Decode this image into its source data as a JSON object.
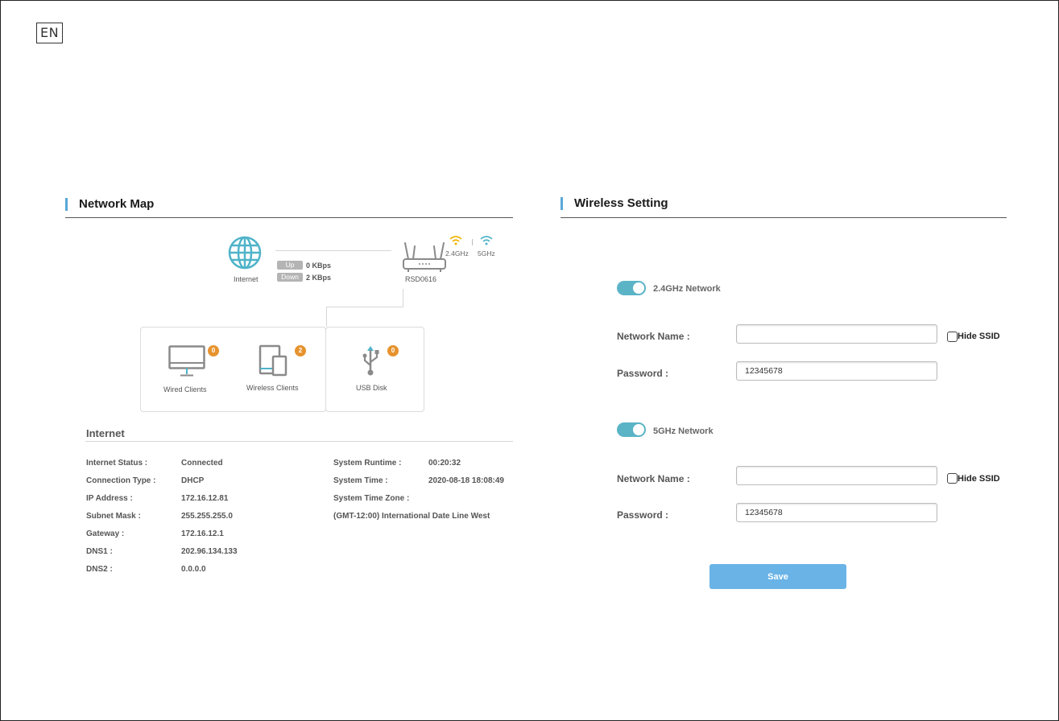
{
  "language": "EN",
  "network_map": {
    "title": "Network Map",
    "internet_label": "Internet",
    "up_tag": "Up",
    "up_value": "0 KBps",
    "down_tag": "Down",
    "down_value": "2 KBps",
    "router_name": "RSD0616",
    "band_24": "2.4GHz",
    "band_5": "5GHz",
    "band_24_color": "#f0b400",
    "band_5_color": "#4fb3c9",
    "clients": [
      {
        "label": "Wired Clients",
        "count": "0",
        "icon": "monitor-icon"
      },
      {
        "label": "Wireless Clients",
        "count": "2",
        "icon": "devices-icon"
      },
      {
        "label": "USB Disk",
        "count": "0",
        "icon": "usb-icon"
      }
    ],
    "badge_color": "#e6932e"
  },
  "internet": {
    "title": "Internet",
    "left": [
      {
        "label": "Internet Status :",
        "value": "Connected"
      },
      {
        "label": "Connection Type :",
        "value": "DHCP"
      },
      {
        "label": "IP Address :",
        "value": "172.16.12.81"
      },
      {
        "label": "Subnet Mask :",
        "value": "255.255.255.0"
      },
      {
        "label": "Gateway :",
        "value": "172.16.12.1"
      },
      {
        "label": "DNS1 :",
        "value": "202.96.134.133"
      },
      {
        "label": "DNS2 :",
        "value": "0.0.0.0"
      }
    ],
    "right": [
      {
        "label": "System Runtime :",
        "value": "00:20:32"
      },
      {
        "label": "System Time :",
        "value": "2020-08-18 18:08:49"
      },
      {
        "label": "System Time Zone :",
        "value": ""
      },
      {
        "label": "(GMT-12:00) International Date Line West",
        "value": ""
      }
    ]
  },
  "wireless": {
    "title": "Wireless Setting",
    "accent_color": "#5ab4c6",
    "band24": {
      "toggle_label": "2.4GHz Network",
      "enabled": true,
      "name_label": "Network Name :",
      "name_value": "",
      "hide_ssid_label": "Hide SSID",
      "hide_ssid_checked": false,
      "password_label": "Password :",
      "password_value": "12345678"
    },
    "band5": {
      "toggle_label": "5GHz Network",
      "enabled": true,
      "name_label": "Network Name :",
      "name_value": "",
      "hide_ssid_label": "Hide SSID",
      "hide_ssid_checked": false,
      "password_label": "Password :",
      "password_value": "12345678"
    },
    "save_label": "Save"
  }
}
